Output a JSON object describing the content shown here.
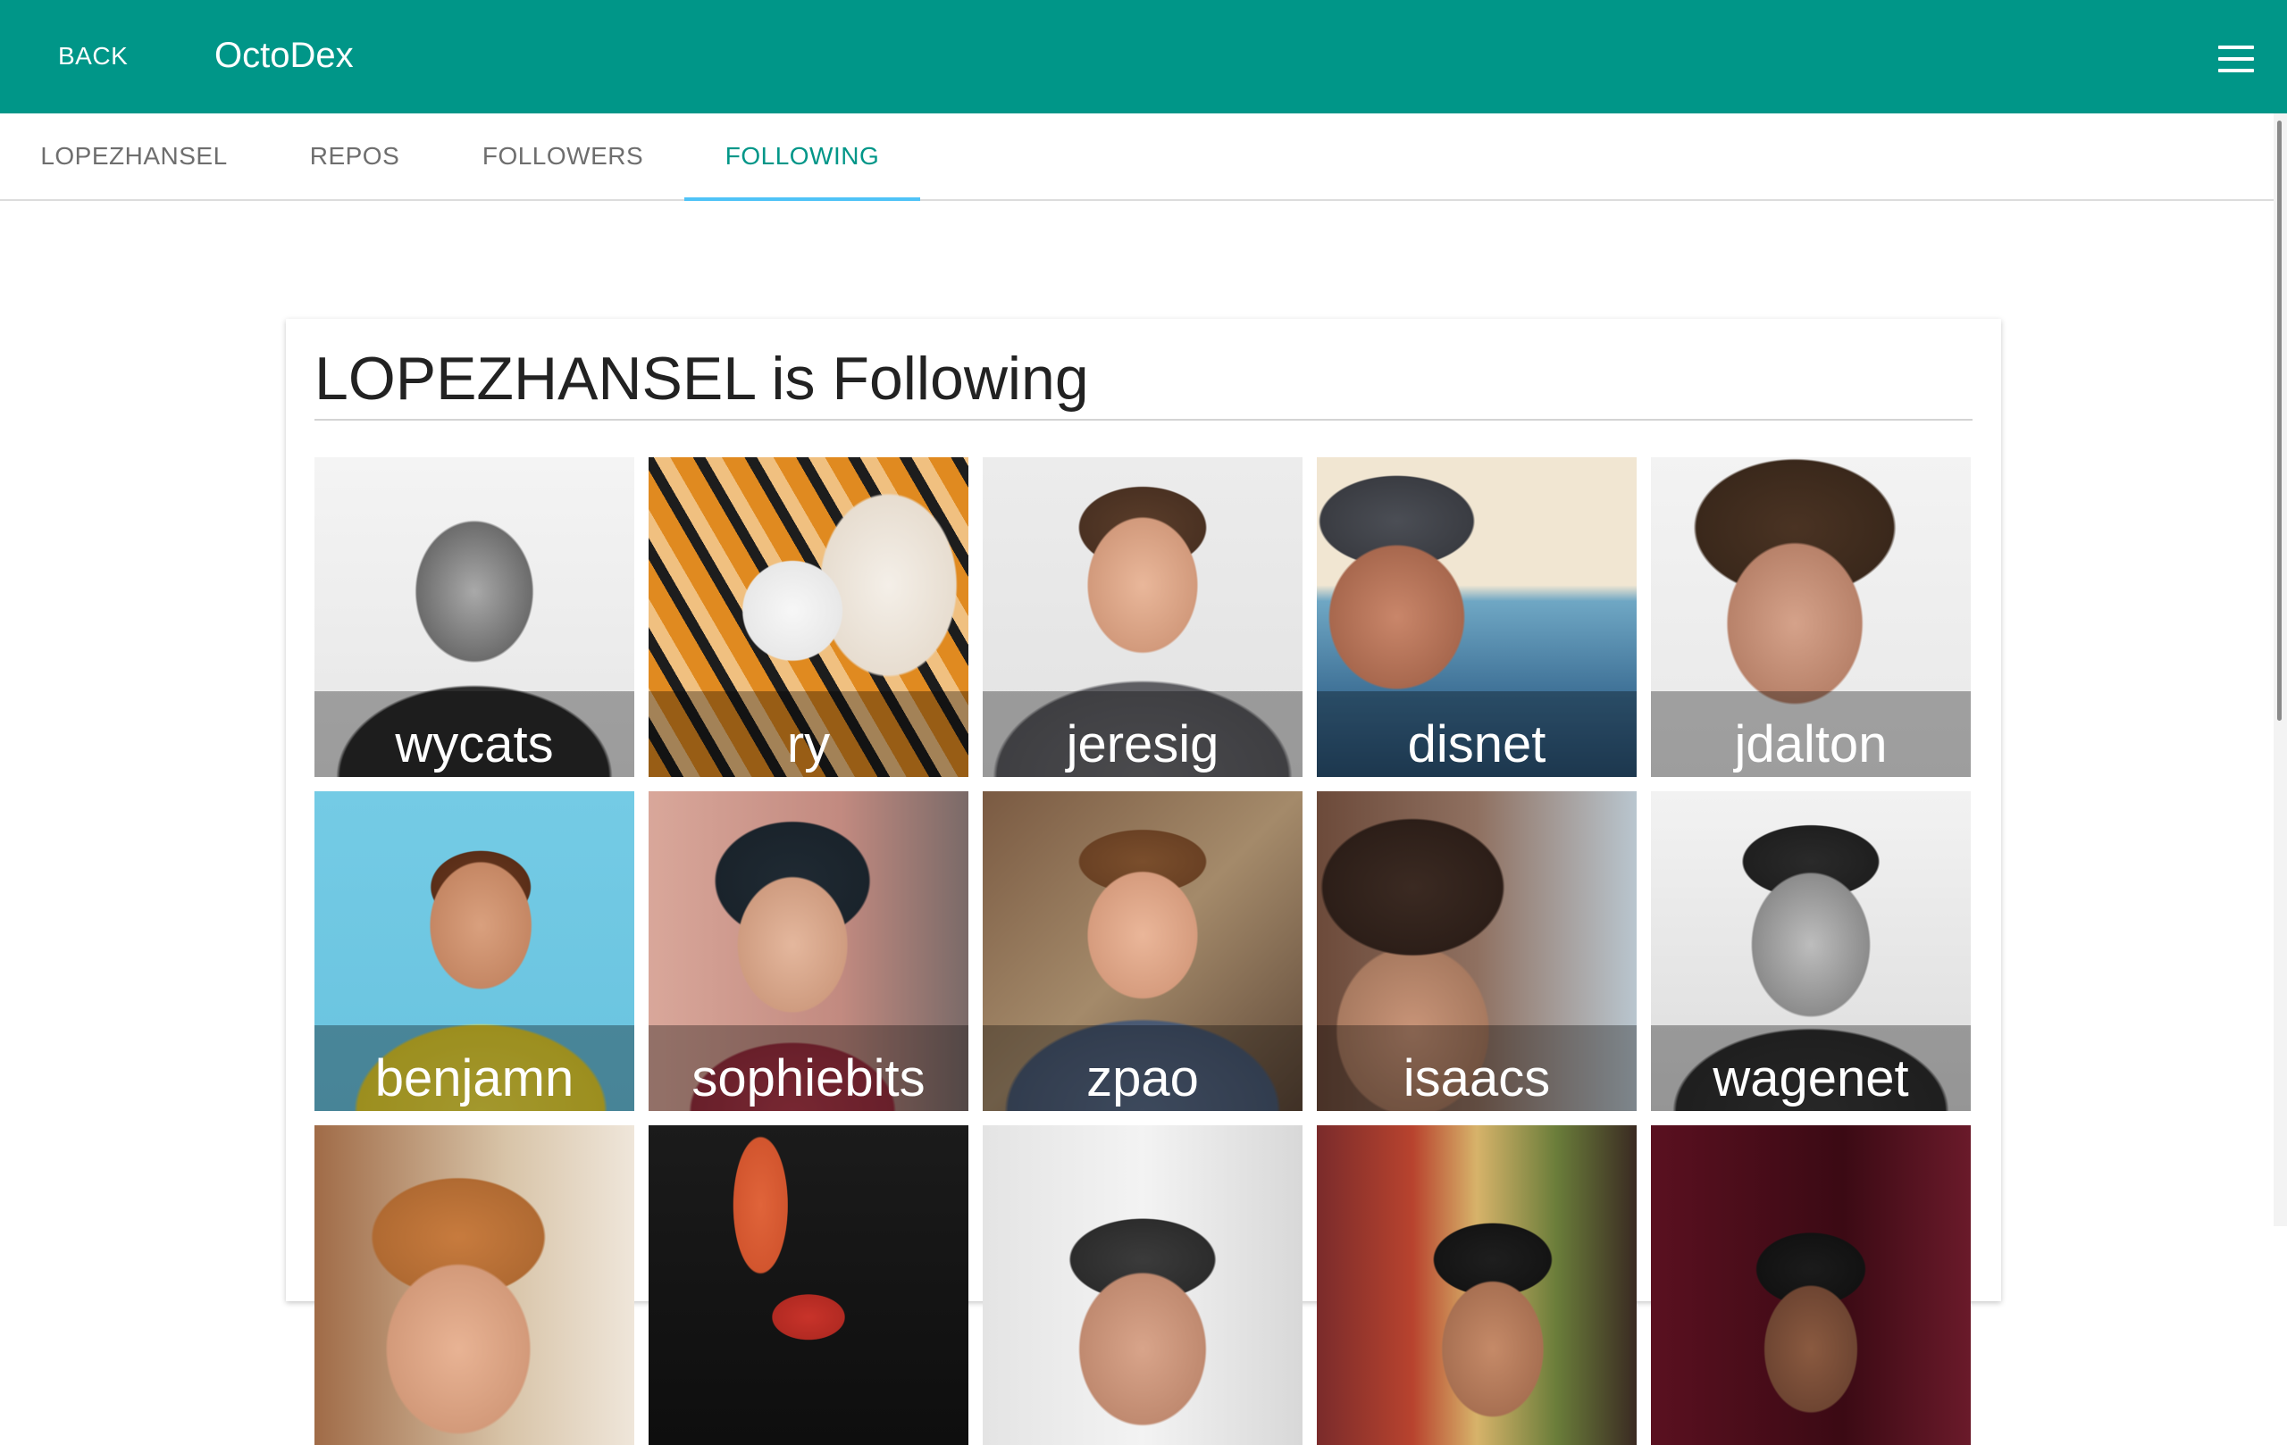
{
  "appbar": {
    "back_label": "BACK",
    "title": "OctoDex",
    "menu_icon": "hamburger-menu-icon",
    "color": "#009688"
  },
  "tabs": [
    {
      "label": "LOPEZHANSEL",
      "active": false
    },
    {
      "label": "REPOS",
      "active": false
    },
    {
      "label": "FOLLOWERS",
      "active": false
    },
    {
      "label": "FOLLOWING",
      "active": true
    }
  ],
  "main": {
    "title": "LOPEZHANSEL is Following"
  },
  "following": [
    {
      "login": "wycats"
    },
    {
      "login": "ry"
    },
    {
      "login": "jeresig"
    },
    {
      "login": "disnet"
    },
    {
      "login": "jdalton"
    },
    {
      "login": "benjamn"
    },
    {
      "login": "sophiebits"
    },
    {
      "login": "zpao"
    },
    {
      "login": "isaacs"
    },
    {
      "login": "wagenet"
    },
    {
      "login": ""
    },
    {
      "login": ""
    },
    {
      "login": ""
    },
    {
      "login": ""
    },
    {
      "login": ""
    }
  ],
  "colors": {
    "accent": "#009688",
    "tab_indicator": "#4fc3f7"
  }
}
